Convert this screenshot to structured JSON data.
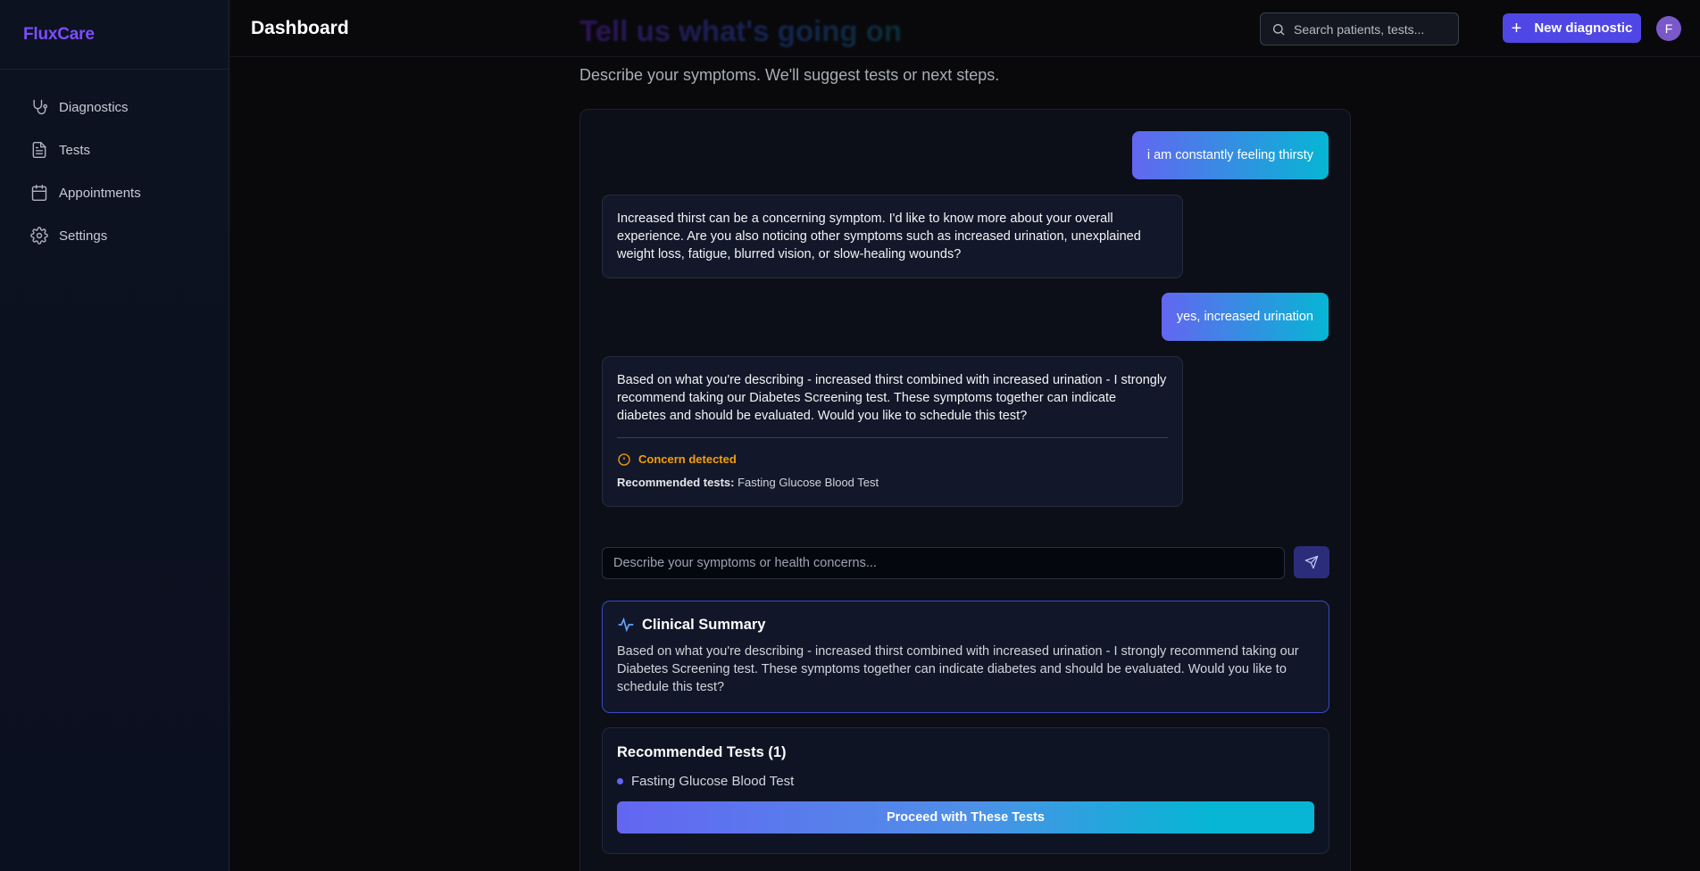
{
  "app": {
    "brand": "FluxCare"
  },
  "sidebar": {
    "items": [
      {
        "label": "Diagnostics",
        "icon": "stethoscope-icon"
      },
      {
        "label": "Tests",
        "icon": "file-text-icon"
      },
      {
        "label": "Appointments",
        "icon": "calendar-icon"
      },
      {
        "label": "Settings",
        "icon": "gear-icon"
      }
    ]
  },
  "header": {
    "title": "Dashboard",
    "hero_heading": "Tell us what's going on",
    "search_placeholder": "Search patients, tests...",
    "new_button": "New diagnostic",
    "avatar_initial": "F"
  },
  "page": {
    "subtitle": "Describe your symptoms. We'll suggest tests or next steps."
  },
  "chat": {
    "messages": [
      {
        "role": "user",
        "text": "i am constantly feeling thirsty"
      },
      {
        "role": "assistant",
        "text": "Increased thirst can be a concerning symptom. I'd like to know more about your overall experience. Are you also noticing other symptoms such as increased urination, unexplained weight loss, fatigue, blurred vision, or slow-healing wounds?"
      },
      {
        "role": "user",
        "text": "yes, increased urination"
      },
      {
        "role": "assistant",
        "text": "Based on what you're describing - increased thirst combined with increased urination - I strongly recommend taking our Diabetes Screening test. These symptoms together can indicate diabetes and should be evaluated. Would you like to schedule this test?",
        "concern_label": "Concern detected",
        "recommended_prefix": "Recommended tests:",
        "recommended_value": "Fasting Glucose Blood Test"
      }
    ],
    "input_placeholder": "Describe your symptoms or health concerns..."
  },
  "summary": {
    "title": "Clinical Summary",
    "text": "Based on what you're describing - increased thirst combined with increased urination - I strongly recommend taking our Diabetes Screening test. These symptoms together can indicate diabetes and should be evaluated. Would you like to schedule this test?"
  },
  "tests": {
    "title": "Recommended Tests (1)",
    "items": [
      "Fasting Glucose Blood Test"
    ],
    "proceed_label": "Proceed with These Tests"
  },
  "colors": {
    "accent": "#5046e5",
    "brand": "#7c4dff",
    "concern": "#f59e0b",
    "gradient_start": "#6366f1",
    "gradient_end": "#06b6d4"
  }
}
